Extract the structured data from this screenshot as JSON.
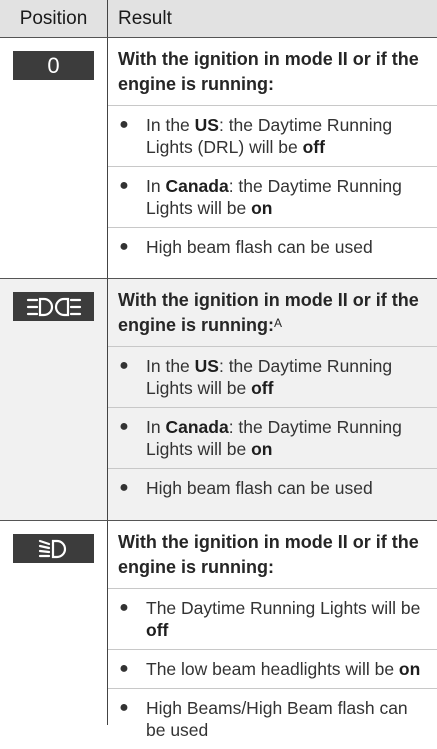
{
  "header": {
    "position": "Position",
    "result": "Result"
  },
  "rows": [
    {
      "badge": "0",
      "icon": "headlight-off-zero",
      "condition": "With the ignition in mode II or if the engine is running:",
      "bullets": [
        {
          "pre": "In the ",
          "bold1": "US",
          "mid": ": the Daytime Running Lights (DRL) will be ",
          "bold2": "off"
        },
        {
          "pre": "In ",
          "bold1": "Canada",
          "mid": ": the Daytime Running Lights will be ",
          "bold2": "on"
        },
        {
          "text": "High beam flash can be used"
        }
      ]
    },
    {
      "icon": "parking-lights-icon",
      "condition": "With the ignition in mode II or if the engine is running:",
      "footnote": "A",
      "bullets": [
        {
          "pre": "In the ",
          "bold1": "US",
          "mid": ": the Daytime Running Lights will be ",
          "bold2": "off"
        },
        {
          "pre": "In ",
          "bold1": "Canada",
          "mid": ": the Daytime Running Lights will be ",
          "bold2": "on"
        },
        {
          "text": "High beam flash can be used"
        }
      ]
    },
    {
      "icon": "low-beam-icon",
      "condition": "With the ignition in mode II or if the engine is running:",
      "bullets": [
        {
          "pre": "The Daytime Running Lights will be ",
          "bold2": "off"
        },
        {
          "pre": "The low beam headlights will be ",
          "bold2": "on"
        },
        {
          "text": "High Beams/High Beam flash can be used"
        }
      ]
    }
  ],
  "colors": {
    "header_bg": "#e2e2e2",
    "shaded_row_bg": "#f1f1f1",
    "badge_bg": "#3c3c3c"
  }
}
